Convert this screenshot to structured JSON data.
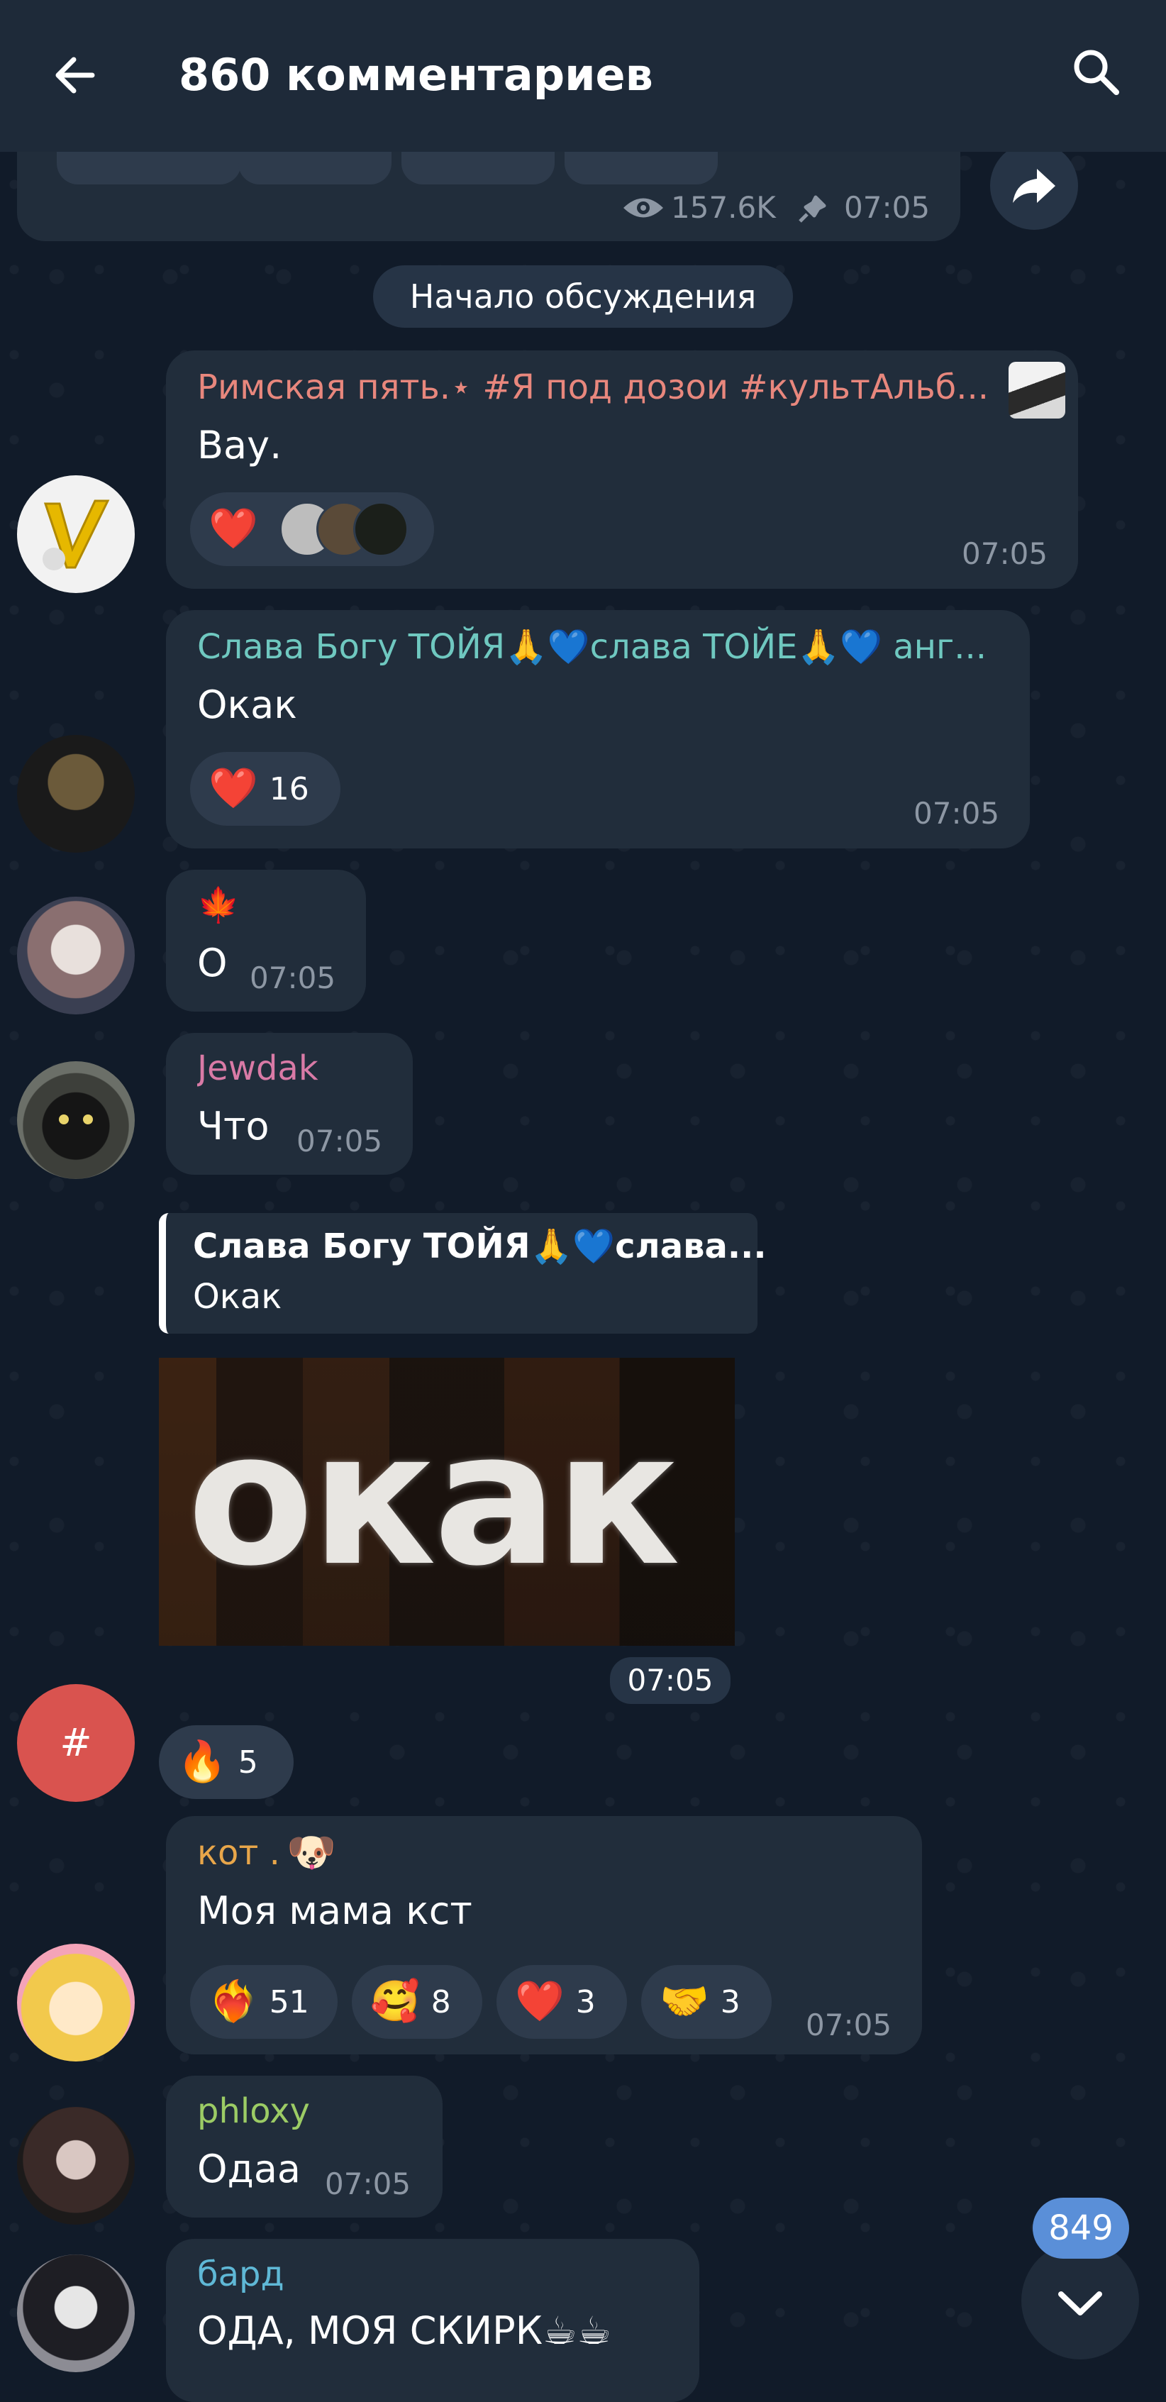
{
  "header": {
    "title": "860 комментариев"
  },
  "channel_post": {
    "views": "157.6K",
    "time": "07:05"
  },
  "discussion_start": "Начало обсуждения",
  "messages": [
    {
      "name": "Римская пять.⋆ #Я под дозои #культАльб...",
      "name_color": "#e8877d",
      "text": "Вау.",
      "time": "07:05",
      "reaction_emoji": "❤️"
    },
    {
      "name": "Слава Богу ТОЙЯ🙏💙слава ТОЙЕ🙏💙 анг...",
      "name_color": "#6fc8c0",
      "text": "Окак",
      "time": "07:05",
      "reaction_emoji": "❤️",
      "reaction_count": "16"
    },
    {
      "name": "🍁",
      "text": "О",
      "time": "07:05"
    },
    {
      "name": "Jewdak",
      "name_color": "#d97aa6",
      "text": "Что",
      "time": "07:05"
    },
    {
      "reply_name": "Слава Богу ТОЙЯ🙏💙слава...",
      "reply_text": "Окак",
      "sticker_text": "окак",
      "time": "07:05",
      "avatar_symbol": "#",
      "reaction_emoji": "🔥",
      "reaction_count": "5"
    },
    {
      "name": "кот .",
      "name_color": "#e8a64a",
      "text": "Моя мама кст",
      "time": "07:05",
      "reactions": [
        {
          "emoji": "❤️‍🔥",
          "count": "51"
        },
        {
          "emoji": "🥰",
          "count": "8"
        },
        {
          "emoji": "❤️",
          "count": "3"
        },
        {
          "emoji": "🤝",
          "count": "3"
        }
      ]
    },
    {
      "name": "phloxy",
      "name_color": "#9ccc65",
      "text": "Одаа",
      "time": "07:05"
    },
    {
      "name": "бард",
      "name_color": "#5fb8d6",
      "text": "ОДА, МОЯ СКИРК☕☕"
    }
  ],
  "scroll_badge": "849"
}
